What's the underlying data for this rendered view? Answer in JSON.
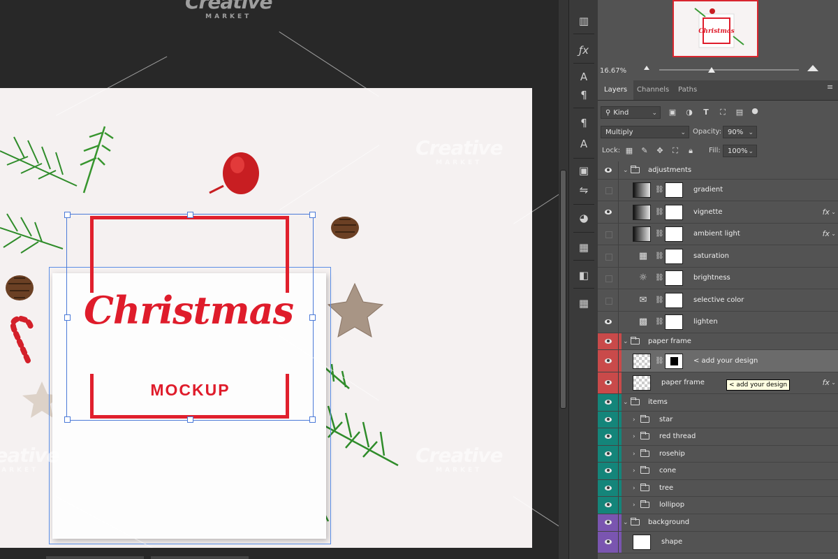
{
  "canvas": {
    "design": {
      "title": "Christmas",
      "subtitle": "MOCKUP"
    },
    "watermark": {
      "brand": "Creative",
      "tag": "MARKET"
    }
  },
  "navigator": {
    "thumb_title": "Christmas",
    "zoom": "16.67%"
  },
  "tabs": [
    "Layers",
    "Channels",
    "Paths"
  ],
  "controls": {
    "filter_kind": "Kind",
    "blend_mode": "Multiply",
    "opacity_label": "Opacity:",
    "opacity_value": "90%",
    "lock_label": "Lock:",
    "fill_label": "Fill:",
    "fill_value": "100%"
  },
  "tooltip": "< add your design",
  "layers": [
    {
      "name": "adjustments",
      "kind": "group",
      "visible": true,
      "color": "none"
    },
    {
      "name": "gradient",
      "kind": "adjustment",
      "visible": false,
      "color": "none",
      "icon": "gradient-icon"
    },
    {
      "name": "vignette",
      "kind": "adjustment",
      "visible": true,
      "color": "none",
      "icon": "gradient-icon",
      "fx": "fx"
    },
    {
      "name": "ambient light",
      "kind": "adjustment",
      "visible": false,
      "color": "none",
      "icon": "gradient-icon",
      "fx": "fx"
    },
    {
      "name": "saturation",
      "kind": "adjustment",
      "visible": false,
      "color": "none",
      "icon": "hue-saturation-icon"
    },
    {
      "name": "brightness",
      "kind": "adjustment",
      "visible": false,
      "color": "none",
      "icon": "brightness-icon"
    },
    {
      "name": "selective color",
      "kind": "adjustment",
      "visible": false,
      "color": "none",
      "icon": "selective-color-icon"
    },
    {
      "name": "lighten",
      "kind": "adjustment",
      "visible": true,
      "color": "none",
      "icon": "curves-icon"
    },
    {
      "name": "paper frame",
      "kind": "group",
      "visible": true,
      "color": "#c94a4a"
    },
    {
      "name": "< add your design",
      "kind": "smart-object",
      "visible": true,
      "color": "#c94a4a",
      "selected": true
    },
    {
      "name": "paper frame",
      "kind": "layer",
      "visible": true,
      "color": "#c94a4a",
      "fx": "fx"
    },
    {
      "name": "items",
      "kind": "group",
      "visible": true,
      "color": "#14857a"
    },
    {
      "name": "star",
      "kind": "subgroup",
      "visible": true,
      "color": "#14857a"
    },
    {
      "name": "red thread",
      "kind": "subgroup",
      "visible": true,
      "color": "#14857a"
    },
    {
      "name": "rosehip",
      "kind": "subgroup",
      "visible": true,
      "color": "#14857a"
    },
    {
      "name": "cone",
      "kind": "subgroup",
      "visible": true,
      "color": "#14857a"
    },
    {
      "name": "tree",
      "kind": "subgroup",
      "visible": true,
      "color": "#14857a"
    },
    {
      "name": "lollipop",
      "kind": "subgroup",
      "visible": true,
      "color": "#14857a"
    },
    {
      "name": "background",
      "kind": "group",
      "visible": true,
      "color": "#7a55b0"
    },
    {
      "name": "shape",
      "kind": "shape",
      "visible": true,
      "color": "#7a55b0"
    }
  ],
  "colors": {
    "red_label": "#c94a4a",
    "green_label": "#14857a",
    "violet_label": "#7a55b0",
    "brand_red": "#df1c2b"
  }
}
